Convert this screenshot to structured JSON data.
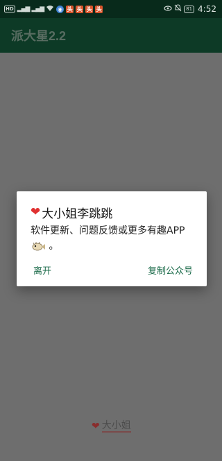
{
  "status_bar": {
    "hd": "HD",
    "time": "4:52",
    "battery": "81",
    "app_icons": [
      "头",
      "头",
      "头",
      "头"
    ]
  },
  "app_bar": {
    "title": "派大星2.2"
  },
  "dialog": {
    "title": "大小姐李跳跳",
    "message": "软件更新、问题反馈或更多有趣APP",
    "message_suffix": "。",
    "leave_label": "离开",
    "copy_label": "复制公众号"
  },
  "bottom": {
    "label": "大小姐"
  },
  "colors": {
    "status_bar": "#082a1b",
    "app_bar": "#0d3a26",
    "scrim": "#6e6e6e",
    "accent": "#1a6a49",
    "heart": "#e03131"
  }
}
